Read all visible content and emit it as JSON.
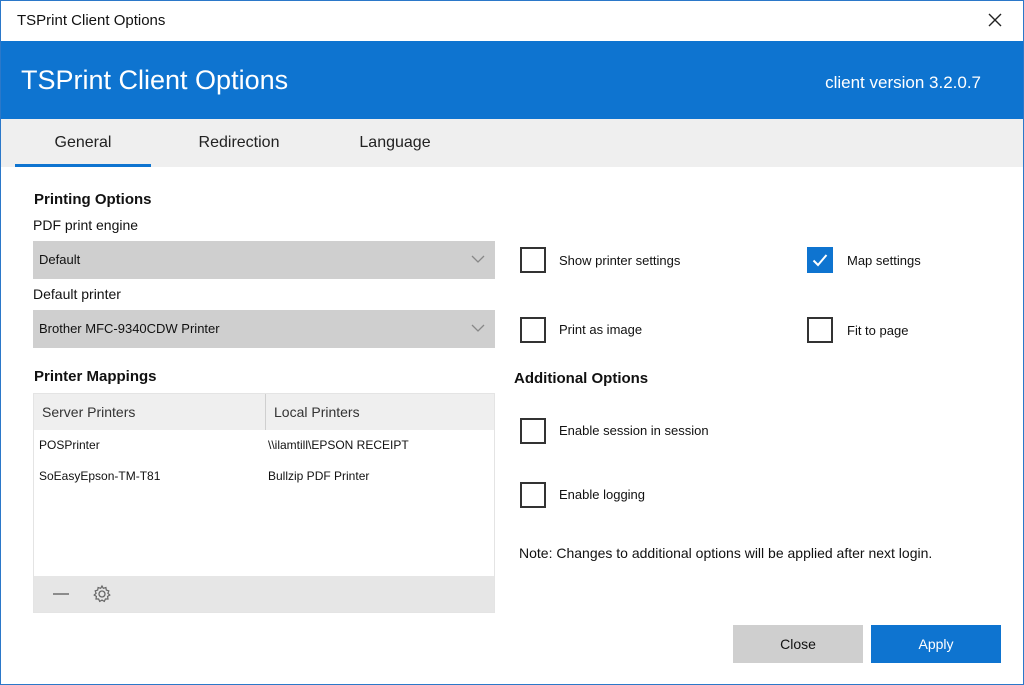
{
  "window": {
    "title": "TSPrint Client Options"
  },
  "header": {
    "title": "TSPrint Client Options",
    "version": "client version 3.2.0.7",
    "accent_color": "#0e74d0"
  },
  "tabs": [
    {
      "label": "General",
      "active": true
    },
    {
      "label": "Redirection",
      "active": false
    },
    {
      "label": "Language",
      "active": false
    }
  ],
  "printing": {
    "section_title": "Printing Options",
    "pdf_engine_label": "PDF print engine",
    "pdf_engine_value": "Default",
    "default_printer_label": "Default printer",
    "default_printer_value": "Brother MFC-9340CDW Printer"
  },
  "options": {
    "show_printer_settings": {
      "label": "Show printer settings",
      "checked": false
    },
    "map_settings": {
      "label": "Map settings",
      "checked": true
    },
    "print_as_image": {
      "label": "Print as image",
      "checked": false
    },
    "fit_to_page": {
      "label": "Fit to page",
      "checked": false
    }
  },
  "mappings": {
    "section_title": "Printer Mappings",
    "columns": [
      "Server Printers",
      "Local Printers"
    ],
    "rows": [
      {
        "server": "POSPrinter",
        "local": "\\\\ilamtill\\EPSON RECEIPT"
      },
      {
        "server": "SoEasyEpson-TM-T81",
        "local": "Bullzip PDF Printer"
      }
    ],
    "footer_icons": [
      "minus-icon",
      "gear-icon"
    ]
  },
  "additional": {
    "section_title": "Additional Options",
    "enable_session": {
      "label": "Enable session in session",
      "checked": false
    },
    "enable_logging": {
      "label": "Enable logging",
      "checked": false
    },
    "note": "Note: Changes to additional options will be applied after next login."
  },
  "buttons": {
    "close": "Close",
    "apply": "Apply"
  }
}
